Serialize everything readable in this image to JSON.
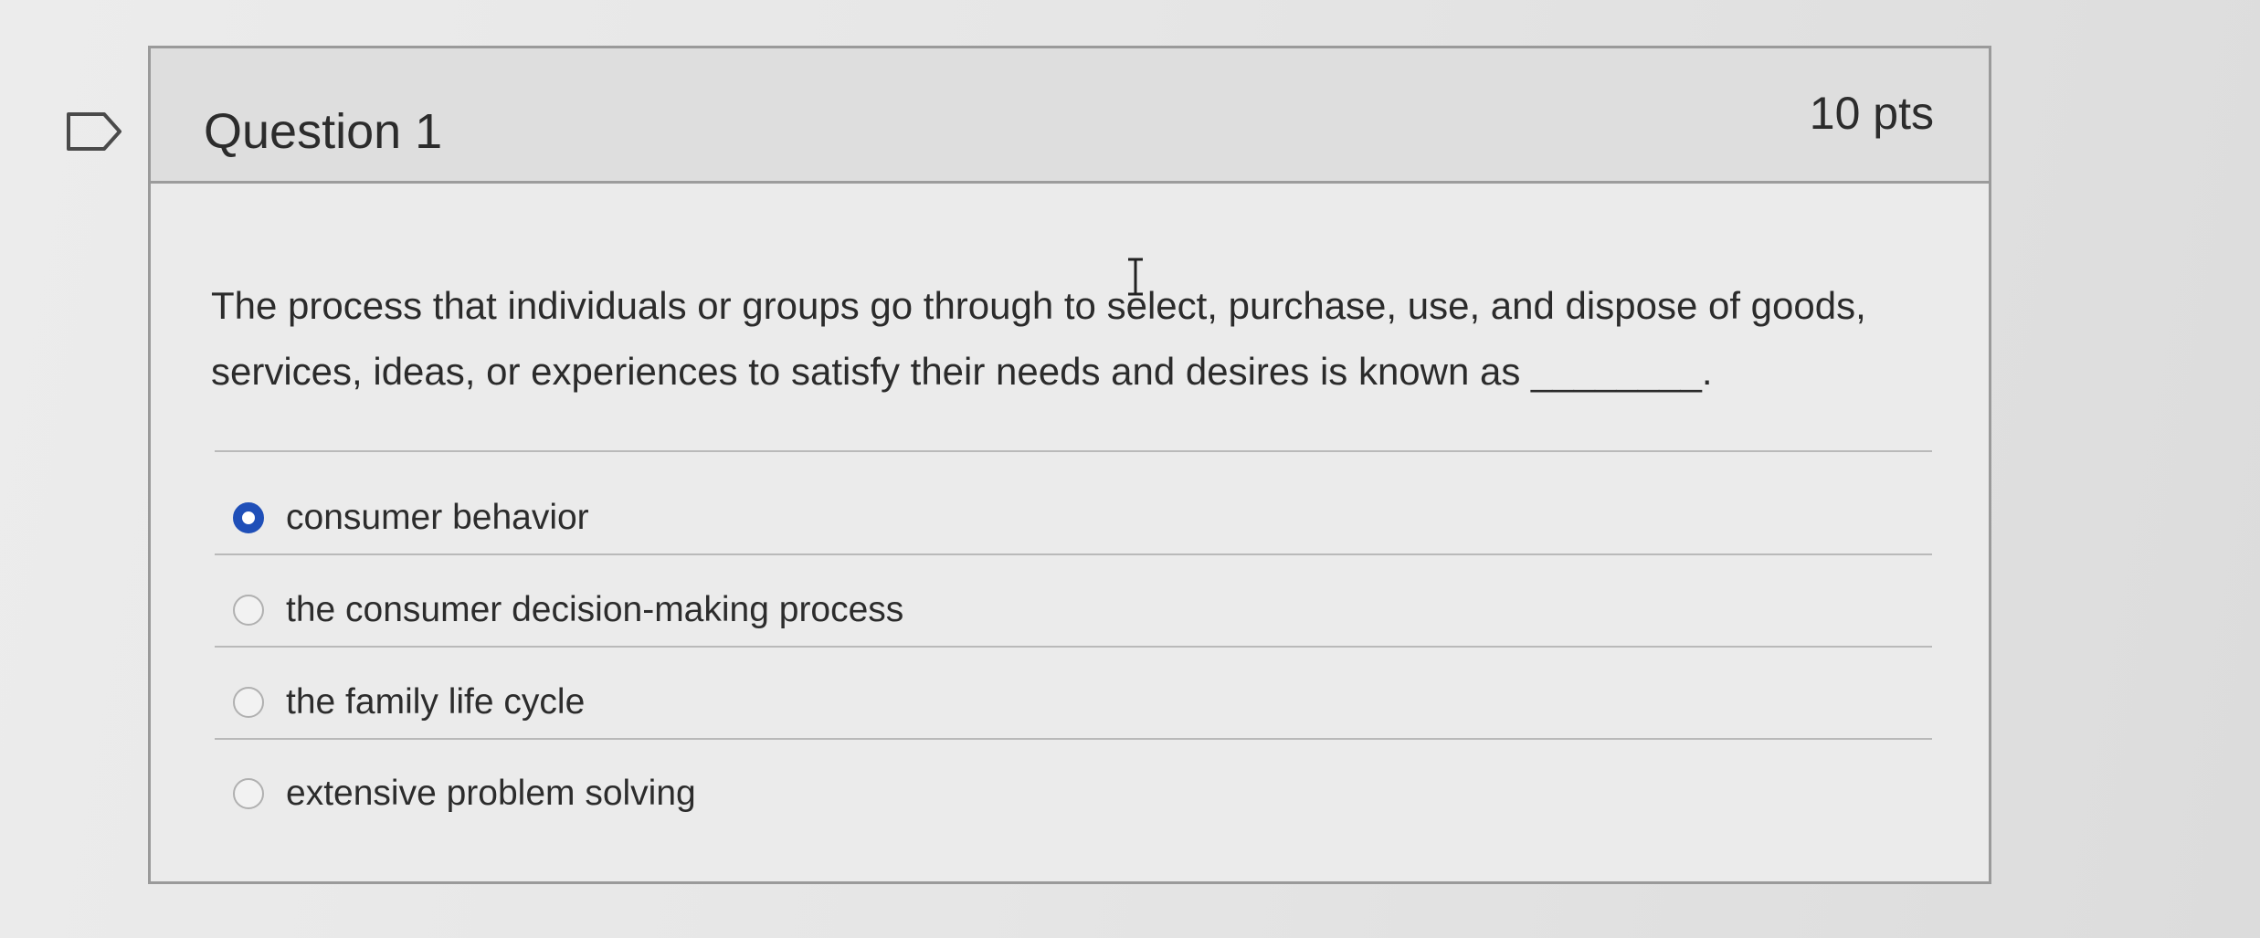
{
  "question": {
    "title": "Question 1",
    "points": "10 pts",
    "text": "The process that individuals or groups go through to select, purchase, use, and dispose of goods, services, ideas, or experiences to satisfy their needs and desires is known as ________."
  },
  "answers": [
    {
      "label": "consumer behavior",
      "selected": true
    },
    {
      "label": "the consumer decision-making process",
      "selected": false
    },
    {
      "label": "the family life cycle",
      "selected": false
    },
    {
      "label": "extensive problem solving",
      "selected": false
    }
  ],
  "icons": {
    "flag": "flag-question-icon",
    "cursor": "text-cursor-icon"
  },
  "colors": {
    "selected_radio": "#1f4fb8",
    "background": "#e6e6e6",
    "header": "#dedede"
  }
}
